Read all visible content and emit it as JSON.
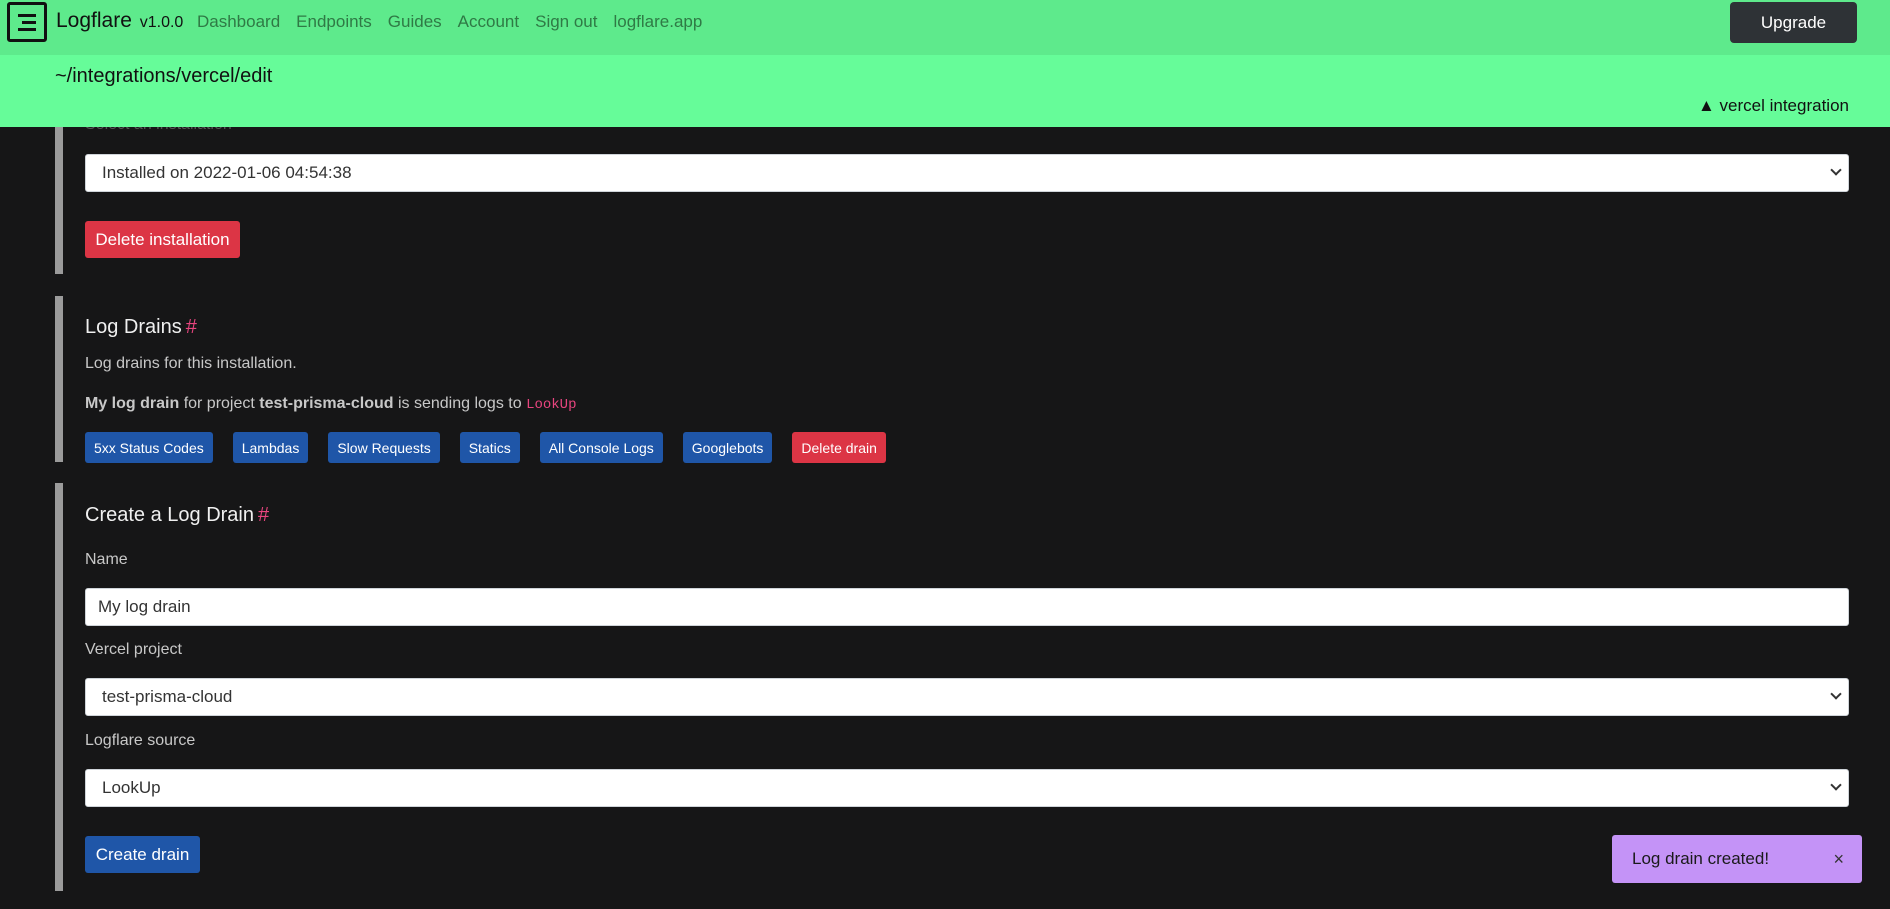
{
  "nav": {
    "brand": "Logflare",
    "version": "v1.0.0",
    "links": [
      "Dashboard",
      "Endpoints",
      "Guides",
      "Account",
      "Sign out",
      "logflare.app"
    ],
    "upgrade_label": "Upgrade"
  },
  "subheader": {
    "path": "~/integrations/vercel/edit",
    "integration_label": "▲ vercel integration"
  },
  "installation": {
    "select_label": "Select an installation",
    "selected": "Installed on 2022-01-06 04:54:38",
    "delete_label": "Delete installation"
  },
  "log_drains": {
    "heading": "Log Drains",
    "hash": "#",
    "description": "Log drains for this installation.",
    "drain_name": "My log drain",
    "for_project": "for project",
    "project": "test-prisma-cloud",
    "sending_to": "is sending logs to",
    "source": "LookUp",
    "buttons": [
      "5xx Status Codes",
      "Lambdas",
      "Slow Requests",
      "Statics",
      "All Console Logs",
      "Googlebots"
    ],
    "delete_label": "Delete drain"
  },
  "create_drain": {
    "heading": "Create a Log Drain",
    "hash": "#",
    "name_label": "Name",
    "name_value": "My log drain",
    "project_label": "Vercel project",
    "project_value": "test-prisma-cloud",
    "source_label": "Logflare source",
    "source_value": "LookUp",
    "submit_label": "Create drain"
  },
  "toast": {
    "message": "Log drain created!",
    "close": "×"
  },
  "colors": {
    "nav_bg": "#5eea8c",
    "subheader_bg": "#66fc99",
    "page_bg": "#161617",
    "primary": "#1f56a8",
    "danger": "#dc3545",
    "toast_bg": "#c493f7",
    "accent_pink": "#e8457f"
  }
}
